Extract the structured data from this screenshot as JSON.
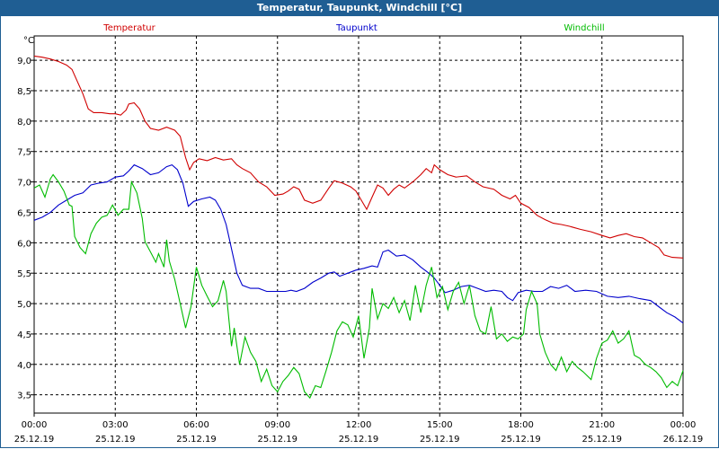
{
  "window": {
    "title": "Temperatur, Taupunkt, Windchill [°C]"
  },
  "chart_data": {
    "type": "line",
    "title": "Temperatur, Taupunkt, Windchill [°C]",
    "ylabel": "°C",
    "ylim": [
      3.2,
      9.4
    ],
    "y_ticks": [
      "9,0",
      "8,5",
      "8,0",
      "7,5",
      "7,0",
      "6,5",
      "6,0",
      "5,5",
      "5,0",
      "4,5",
      "4,0",
      "3,5"
    ],
    "y_tick_values": [
      9.0,
      8.5,
      8.0,
      7.5,
      7.0,
      6.5,
      6.0,
      5.5,
      5.0,
      4.5,
      4.0,
      3.5
    ],
    "x_ticks": [
      {
        "time": "00:00",
        "date": "25.12.19"
      },
      {
        "time": "03:00",
        "date": "25.12.19"
      },
      {
        "time": "06:00",
        "date": "25.12.19"
      },
      {
        "time": "09:00",
        "date": "25.12.19"
      },
      {
        "time": "12:00",
        "date": "25.12.19"
      },
      {
        "time": "15:00",
        "date": "25.12.19"
      },
      {
        "time": "18:00",
        "date": "25.12.19"
      },
      {
        "time": "21:00",
        "date": "25.12.19"
      },
      {
        "time": "00:00",
        "date": "26.12.19"
      }
    ],
    "x_hours": [
      0,
      24
    ],
    "grid": true,
    "legend": "top",
    "series": [
      {
        "name": "Temperatur",
        "color": "#d00000",
        "points": [
          [
            0,
            9.07
          ],
          [
            0.3,
            9.05
          ],
          [
            0.6,
            9.02
          ],
          [
            0.9,
            8.98
          ],
          [
            1.2,
            8.92
          ],
          [
            1.4,
            8.85
          ],
          [
            1.6,
            8.65
          ],
          [
            1.8,
            8.45
          ],
          [
            2.0,
            8.2
          ],
          [
            2.2,
            8.14
          ],
          [
            2.5,
            8.14
          ],
          [
            2.8,
            8.12
          ],
          [
            3.0,
            8.12
          ],
          [
            3.2,
            8.1
          ],
          [
            3.4,
            8.18
          ],
          [
            3.5,
            8.28
          ],
          [
            3.7,
            8.3
          ],
          [
            3.9,
            8.2
          ],
          [
            4.1,
            8.0
          ],
          [
            4.3,
            7.88
          ],
          [
            4.6,
            7.85
          ],
          [
            4.9,
            7.9
          ],
          [
            5.2,
            7.85
          ],
          [
            5.4,
            7.75
          ],
          [
            5.6,
            7.4
          ],
          [
            5.75,
            7.2
          ],
          [
            5.9,
            7.32
          ],
          [
            6.1,
            7.38
          ],
          [
            6.4,
            7.35
          ],
          [
            6.7,
            7.4
          ],
          [
            7.0,
            7.36
          ],
          [
            7.3,
            7.38
          ],
          [
            7.5,
            7.28
          ],
          [
            7.7,
            7.22
          ],
          [
            8.0,
            7.15
          ],
          [
            8.3,
            7.0
          ],
          [
            8.6,
            6.92
          ],
          [
            8.9,
            6.78
          ],
          [
            9.2,
            6.8
          ],
          [
            9.4,
            6.85
          ],
          [
            9.6,
            6.92
          ],
          [
            9.8,
            6.88
          ],
          [
            10.0,
            6.7
          ],
          [
            10.3,
            6.65
          ],
          [
            10.6,
            6.7
          ],
          [
            10.9,
            6.9
          ],
          [
            11.1,
            7.02
          ],
          [
            11.4,
            6.98
          ],
          [
            11.7,
            6.92
          ],
          [
            11.9,
            6.85
          ],
          [
            12.1,
            6.7
          ],
          [
            12.3,
            6.55
          ],
          [
            12.5,
            6.75
          ],
          [
            12.7,
            6.95
          ],
          [
            12.9,
            6.9
          ],
          [
            13.1,
            6.78
          ],
          [
            13.3,
            6.88
          ],
          [
            13.5,
            6.95
          ],
          [
            13.7,
            6.9
          ],
          [
            14.0,
            7.0
          ],
          [
            14.3,
            7.12
          ],
          [
            14.5,
            7.22
          ],
          [
            14.7,
            7.15
          ],
          [
            14.8,
            7.28
          ],
          [
            15.0,
            7.2
          ],
          [
            15.3,
            7.12
          ],
          [
            15.6,
            7.08
          ],
          [
            16.0,
            7.1
          ],
          [
            16.3,
            7.0
          ],
          [
            16.6,
            6.92
          ],
          [
            17.0,
            6.88
          ],
          [
            17.3,
            6.78
          ],
          [
            17.6,
            6.72
          ],
          [
            17.8,
            6.78
          ],
          [
            18.0,
            6.65
          ],
          [
            18.3,
            6.58
          ],
          [
            18.6,
            6.45
          ],
          [
            18.9,
            6.38
          ],
          [
            19.2,
            6.32
          ],
          [
            19.5,
            6.3
          ],
          [
            19.8,
            6.27
          ],
          [
            20.2,
            6.22
          ],
          [
            20.6,
            6.18
          ],
          [
            21.0,
            6.12
          ],
          [
            21.3,
            6.08
          ],
          [
            21.6,
            6.12
          ],
          [
            21.9,
            6.15
          ],
          [
            22.2,
            6.1
          ],
          [
            22.5,
            6.08
          ],
          [
            22.8,
            6.0
          ],
          [
            23.1,
            5.92
          ],
          [
            23.3,
            5.8
          ],
          [
            23.6,
            5.76
          ],
          [
            24.0,
            5.75
          ]
        ]
      },
      {
        "name": "Taupunkt",
        "color": "#0000cc",
        "points": [
          [
            0,
            6.37
          ],
          [
            0.3,
            6.42
          ],
          [
            0.6,
            6.5
          ],
          [
            0.9,
            6.62
          ],
          [
            1.2,
            6.7
          ],
          [
            1.5,
            6.78
          ],
          [
            1.8,
            6.82
          ],
          [
            2.1,
            6.95
          ],
          [
            2.4,
            6.98
          ],
          [
            2.7,
            7.0
          ],
          [
            3.0,
            7.08
          ],
          [
            3.3,
            7.1
          ],
          [
            3.5,
            7.18
          ],
          [
            3.7,
            7.28
          ],
          [
            4.0,
            7.22
          ],
          [
            4.3,
            7.12
          ],
          [
            4.6,
            7.15
          ],
          [
            4.9,
            7.25
          ],
          [
            5.1,
            7.28
          ],
          [
            5.3,
            7.2
          ],
          [
            5.5,
            6.98
          ],
          [
            5.7,
            6.6
          ],
          [
            5.9,
            6.68
          ],
          [
            6.2,
            6.72
          ],
          [
            6.5,
            6.75
          ],
          [
            6.7,
            6.7
          ],
          [
            6.9,
            6.55
          ],
          [
            7.1,
            6.3
          ],
          [
            7.3,
            5.9
          ],
          [
            7.5,
            5.5
          ],
          [
            7.7,
            5.3
          ],
          [
            8.0,
            5.25
          ],
          [
            8.3,
            5.25
          ],
          [
            8.6,
            5.2
          ],
          [
            9.0,
            5.2
          ],
          [
            9.3,
            5.2
          ],
          [
            9.5,
            5.22
          ],
          [
            9.7,
            5.2
          ],
          [
            10.0,
            5.25
          ],
          [
            10.3,
            5.35
          ],
          [
            10.6,
            5.42
          ],
          [
            10.9,
            5.5
          ],
          [
            11.1,
            5.52
          ],
          [
            11.3,
            5.45
          ],
          [
            11.6,
            5.5
          ],
          [
            11.9,
            5.55
          ],
          [
            12.2,
            5.58
          ],
          [
            12.5,
            5.62
          ],
          [
            12.7,
            5.6
          ],
          [
            12.9,
            5.85
          ],
          [
            13.1,
            5.88
          ],
          [
            13.4,
            5.78
          ],
          [
            13.7,
            5.8
          ],
          [
            14.0,
            5.72
          ],
          [
            14.3,
            5.6
          ],
          [
            14.6,
            5.5
          ],
          [
            14.8,
            5.42
          ],
          [
            15.0,
            5.3
          ],
          [
            15.2,
            5.18
          ],
          [
            15.5,
            5.22
          ],
          [
            15.8,
            5.28
          ],
          [
            16.1,
            5.3
          ],
          [
            16.4,
            5.25
          ],
          [
            16.7,
            5.2
          ],
          [
            17.0,
            5.22
          ],
          [
            17.3,
            5.2
          ],
          [
            17.5,
            5.1
          ],
          [
            17.7,
            5.05
          ],
          [
            17.9,
            5.18
          ],
          [
            18.2,
            5.22
          ],
          [
            18.5,
            5.2
          ],
          [
            18.8,
            5.2
          ],
          [
            19.1,
            5.28
          ],
          [
            19.4,
            5.25
          ],
          [
            19.7,
            5.3
          ],
          [
            20.0,
            5.2
          ],
          [
            20.4,
            5.22
          ],
          [
            20.8,
            5.2
          ],
          [
            21.2,
            5.12
          ],
          [
            21.6,
            5.1
          ],
          [
            22.0,
            5.12
          ],
          [
            22.4,
            5.08
          ],
          [
            22.8,
            5.05
          ],
          [
            23.1,
            4.95
          ],
          [
            23.4,
            4.85
          ],
          [
            23.7,
            4.78
          ],
          [
            24.0,
            4.68
          ]
        ]
      },
      {
        "name": "Windchill",
        "color": "#00bb00",
        "points": [
          [
            0,
            6.9
          ],
          [
            0.2,
            6.95
          ],
          [
            0.4,
            6.75
          ],
          [
            0.6,
            7.05
          ],
          [
            0.7,
            7.12
          ],
          [
            0.9,
            7.0
          ],
          [
            1.1,
            6.85
          ],
          [
            1.3,
            6.62
          ],
          [
            1.4,
            6.6
          ],
          [
            1.5,
            6.1
          ],
          [
            1.7,
            5.92
          ],
          [
            1.9,
            5.82
          ],
          [
            2.1,
            6.15
          ],
          [
            2.3,
            6.32
          ],
          [
            2.5,
            6.42
          ],
          [
            2.7,
            6.45
          ],
          [
            2.9,
            6.62
          ],
          [
            3.1,
            6.45
          ],
          [
            3.3,
            6.55
          ],
          [
            3.5,
            6.55
          ],
          [
            3.6,
            7.0
          ],
          [
            3.8,
            6.82
          ],
          [
            4.0,
            6.4
          ],
          [
            4.1,
            6.02
          ],
          [
            4.3,
            5.85
          ],
          [
            4.5,
            5.68
          ],
          [
            4.6,
            5.82
          ],
          [
            4.8,
            5.6
          ],
          [
            4.9,
            6.05
          ],
          [
            5.0,
            5.7
          ],
          [
            5.2,
            5.4
          ],
          [
            5.4,
            5.0
          ],
          [
            5.6,
            4.6
          ],
          [
            5.8,
            4.95
          ],
          [
            6.0,
            5.6
          ],
          [
            6.2,
            5.3
          ],
          [
            6.4,
            5.12
          ],
          [
            6.6,
            4.95
          ],
          [
            6.8,
            5.05
          ],
          [
            7.0,
            5.38
          ],
          [
            7.1,
            5.2
          ],
          [
            7.3,
            4.3
          ],
          [
            7.4,
            4.6
          ],
          [
            7.6,
            4.0
          ],
          [
            7.8,
            4.45
          ],
          [
            8.0,
            4.2
          ],
          [
            8.2,
            4.05
          ],
          [
            8.4,
            3.72
          ],
          [
            8.6,
            3.92
          ],
          [
            8.8,
            3.65
          ],
          [
            9.0,
            3.55
          ],
          [
            9.2,
            3.72
          ],
          [
            9.4,
            3.82
          ],
          [
            9.6,
            3.95
          ],
          [
            9.8,
            3.85
          ],
          [
            10.0,
            3.55
          ],
          [
            10.2,
            3.45
          ],
          [
            10.4,
            3.65
          ],
          [
            10.6,
            3.62
          ],
          [
            10.8,
            3.9
          ],
          [
            11.0,
            4.2
          ],
          [
            11.2,
            4.55
          ],
          [
            11.4,
            4.7
          ],
          [
            11.6,
            4.65
          ],
          [
            11.8,
            4.45
          ],
          [
            12.0,
            4.8
          ],
          [
            12.2,
            4.1
          ],
          [
            12.4,
            4.6
          ],
          [
            12.5,
            5.25
          ],
          [
            12.7,
            4.75
          ],
          [
            12.9,
            5.0
          ],
          [
            13.1,
            4.92
          ],
          [
            13.3,
            5.1
          ],
          [
            13.5,
            4.85
          ],
          [
            13.7,
            5.05
          ],
          [
            13.9,
            4.72
          ],
          [
            14.1,
            5.3
          ],
          [
            14.3,
            4.85
          ],
          [
            14.5,
            5.3
          ],
          [
            14.7,
            5.6
          ],
          [
            14.9,
            5.1
          ],
          [
            15.1,
            5.28
          ],
          [
            15.3,
            4.9
          ],
          [
            15.5,
            5.2
          ],
          [
            15.7,
            5.35
          ],
          [
            15.9,
            5.0
          ],
          [
            16.1,
            5.3
          ],
          [
            16.3,
            4.8
          ],
          [
            16.5,
            4.55
          ],
          [
            16.7,
            4.5
          ],
          [
            16.9,
            4.95
          ],
          [
            17.1,
            4.42
          ],
          [
            17.3,
            4.5
          ],
          [
            17.5,
            4.38
          ],
          [
            17.7,
            4.45
          ],
          [
            17.9,
            4.42
          ],
          [
            18.1,
            4.5
          ],
          [
            18.2,
            4.9
          ],
          [
            18.4,
            5.2
          ],
          [
            18.6,
            5.0
          ],
          [
            18.7,
            4.5
          ],
          [
            18.9,
            4.2
          ],
          [
            19.1,
            4.0
          ],
          [
            19.3,
            3.9
          ],
          [
            19.5,
            4.12
          ],
          [
            19.7,
            3.88
          ],
          [
            19.9,
            4.05
          ],
          [
            20.1,
            3.95
          ],
          [
            20.3,
            3.88
          ],
          [
            20.6,
            3.75
          ],
          [
            20.8,
            4.1
          ],
          [
            21.0,
            4.35
          ],
          [
            21.2,
            4.4
          ],
          [
            21.4,
            4.55
          ],
          [
            21.6,
            4.35
          ],
          [
            21.8,
            4.42
          ],
          [
            22.0,
            4.55
          ],
          [
            22.2,
            4.15
          ],
          [
            22.4,
            4.1
          ],
          [
            22.6,
            4.0
          ],
          [
            22.8,
            3.95
          ],
          [
            23.0,
            3.88
          ],
          [
            23.2,
            3.78
          ],
          [
            23.4,
            3.62
          ],
          [
            23.6,
            3.72
          ],
          [
            23.8,
            3.65
          ],
          [
            24.0,
            3.9
          ]
        ]
      }
    ]
  }
}
